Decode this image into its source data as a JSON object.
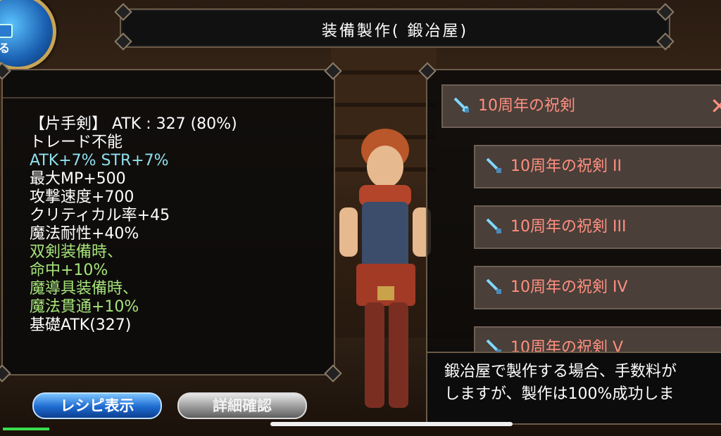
{
  "header": {
    "title": "装備製作( 鍛冶屋)"
  },
  "orb": {
    "label": "る"
  },
  "item_stats": {
    "lines": [
      {
        "text": "【片手剣】 ATK : 327 (80%)",
        "color": "white"
      },
      {
        "text": "トレード不能",
        "color": "white"
      },
      {
        "text": "ATK+7% STR+7%",
        "color": "cyan"
      },
      {
        "text": "最大MP+500",
        "color": "white"
      },
      {
        "text": "攻撃速度+700",
        "color": "white"
      },
      {
        "text": "クリティカル率+45",
        "color": "white"
      },
      {
        "text": "魔法耐性+40%",
        "color": "white"
      },
      {
        "text": "双剣装備時、",
        "color": "green"
      },
      {
        "text": "命中+10%",
        "color": "green"
      },
      {
        "text": "魔導具装備時、",
        "color": "green"
      },
      {
        "text": "魔法貫通+10%",
        "color": "green"
      },
      {
        "text": "基礎ATK(327)",
        "color": "white"
      }
    ]
  },
  "buttons": {
    "recipe": "レシピ表示",
    "detail": "詳細確認"
  },
  "recipe_list": {
    "items": [
      {
        "label": "10周年の祝剣",
        "icon": "sword-icon"
      },
      {
        "label": "10周年の祝剣 II",
        "icon": "sword-icon"
      },
      {
        "label": "10周年の祝剣 III",
        "icon": "sword-icon"
      },
      {
        "label": "10周年の祝剣 IV",
        "icon": "sword-icon"
      },
      {
        "label": "10周年の祝剣 V",
        "icon": "sword-icon"
      }
    ],
    "close_glyph": "✕"
  },
  "description": {
    "line1": "鍛冶屋で製作する場合、手数料が",
    "line2": "しますが、製作は100%成功しま"
  },
  "colors": {
    "cyan": "#8fe0ee",
    "green": "#a6e37a",
    "item_text": "#ff8f80"
  }
}
